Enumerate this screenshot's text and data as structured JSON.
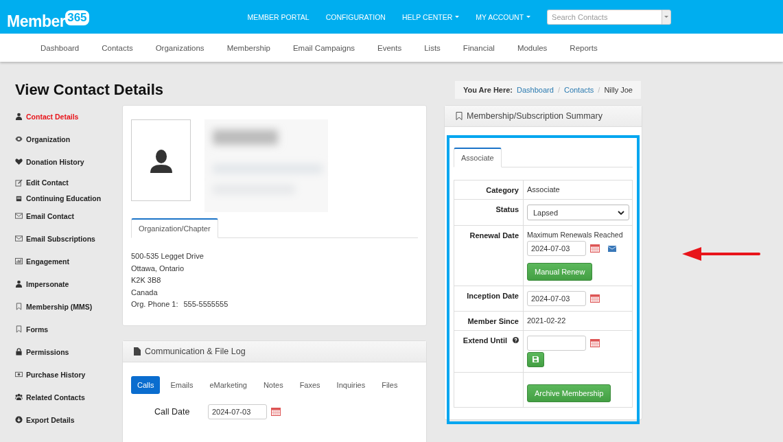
{
  "header": {
    "logo": {
      "word": "Member",
      "badge": "365"
    },
    "menu": [
      {
        "label": "MEMBER PORTAL",
        "dropdown": false
      },
      {
        "label": "CONFIGURATION",
        "dropdown": false
      },
      {
        "label": "HELP CENTER",
        "dropdown": true
      },
      {
        "label": "MY ACCOUNT",
        "dropdown": true
      }
    ],
    "search": {
      "placeholder": "Search Contacts"
    }
  },
  "nav": [
    "Dashboard",
    "Contacts",
    "Organizations",
    "Membership",
    "Email Campaigns",
    "Events",
    "Lists",
    "Financial",
    "Modules",
    "Reports"
  ],
  "page_title": "View Contact Details",
  "breadcrumb": {
    "label": "You Are Here:",
    "links": [
      "Dashboard",
      "Contacts"
    ],
    "separator": "/",
    "current": "Nilly Joe"
  },
  "sidebar": {
    "items": [
      {
        "label": "Contact Details",
        "selected": true
      },
      {
        "label": "Organization",
        "selected": false
      },
      {
        "label": "Donation History",
        "selected": false
      },
      {
        "label": "Edit Contact",
        "selected": false
      },
      {
        "label": "Continuing Education",
        "selected": false
      },
      {
        "label": "Email Contact",
        "selected": false
      },
      {
        "label": "Email Subscriptions",
        "selected": false
      },
      {
        "label": "Engagement",
        "selected": false
      },
      {
        "label": "Impersonate",
        "selected": false
      },
      {
        "label": "Membership (MMS)",
        "selected": false
      },
      {
        "label": "Forms",
        "selected": false
      },
      {
        "label": "Permissions",
        "selected": false
      },
      {
        "label": "Purchase History",
        "selected": false
      },
      {
        "label": "Related Contacts",
        "selected": false
      },
      {
        "label": "Export Details",
        "selected": false
      }
    ]
  },
  "contact_card": {
    "tabs": [
      {
        "label": "Organization/Chapter",
        "selected": true
      }
    ],
    "address_lines": [
      "500-535 Legget Drive",
      "Ottawa, Ontario",
      "K2K 3B8",
      "Canada"
    ],
    "phone": {
      "label": "Org. Phone 1:",
      "value": "555-5555555"
    }
  },
  "communication_log": {
    "title": "Communication & File Log",
    "tabs": [
      {
        "label": "Calls",
        "selected": true
      },
      {
        "label": "Emails",
        "selected": false
      },
      {
        "label": "eMarketing",
        "selected": false
      },
      {
        "label": "Notes",
        "selected": false
      },
      {
        "label": "Faxes",
        "selected": false
      },
      {
        "label": "Inquiries",
        "selected": false
      },
      {
        "label": "Files",
        "selected": false
      }
    ],
    "call_date": {
      "label": "Call Date",
      "value": "2024-07-03"
    }
  },
  "membership_summary": {
    "title": "Membership/Subscription Summary",
    "highlighted": true,
    "tabs": [
      {
        "label": "Associate",
        "selected": true
      }
    ],
    "rows": [
      {
        "kind": "text",
        "label": "Category",
        "value": "Associate"
      },
      {
        "kind": "select",
        "label": "Status",
        "value": "Lapsed"
      },
      {
        "kind": "renewal",
        "label": "Renewal Date",
        "note": "Maximum Renewals Reached",
        "value": "2024-07-03",
        "button": "Manual Renew"
      },
      {
        "kind": "date",
        "label": "Inception Date",
        "value": "2024-07-03"
      },
      {
        "kind": "text",
        "label": "Member Since",
        "value": "2021-02-22"
      },
      {
        "kind": "extend",
        "label": "Extend Until",
        "help": true
      },
      {
        "kind": "action",
        "button": "Archive Membership"
      }
    ]
  },
  "annotation": {
    "arrow": true
  }
}
